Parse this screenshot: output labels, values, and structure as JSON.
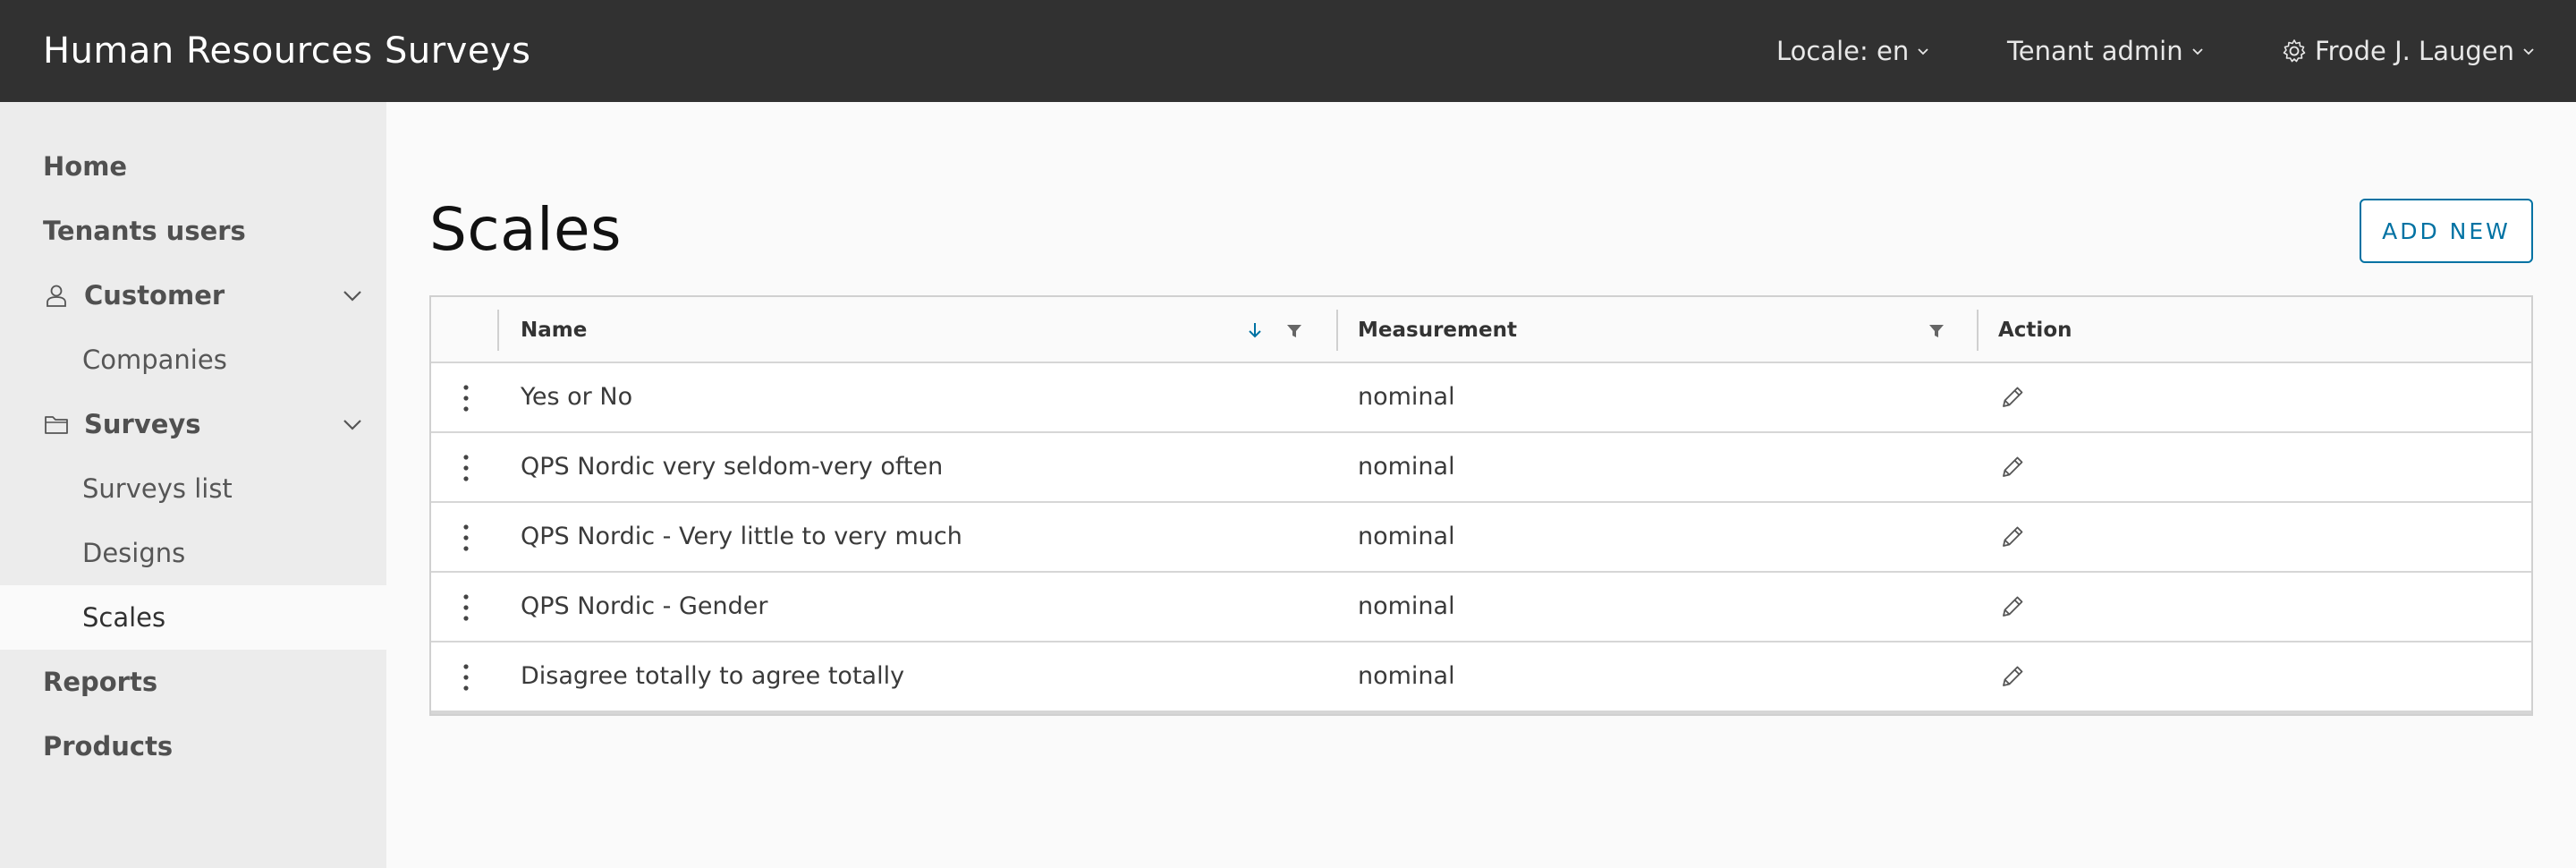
{
  "header": {
    "title": "Human Resources Surveys",
    "locale_label": "Locale: en",
    "tenant_label": "Tenant admin",
    "user_label": "Frode J. Laugen"
  },
  "sidebar": {
    "items": [
      {
        "label": "Home",
        "level": "top"
      },
      {
        "label": "Tenants users",
        "level": "top"
      },
      {
        "label": "Customer",
        "level": "top",
        "icon": "person-icon",
        "expanded": true
      },
      {
        "label": "Companies",
        "level": "sub"
      },
      {
        "label": "Surveys",
        "level": "top",
        "icon": "folder-icon",
        "expanded": true
      },
      {
        "label": "Surveys list",
        "level": "sub"
      },
      {
        "label": "Designs",
        "level": "sub"
      },
      {
        "label": "Scales",
        "level": "sub",
        "active": true
      },
      {
        "label": "Reports",
        "level": "top"
      },
      {
        "label": "Products",
        "level": "top"
      }
    ]
  },
  "main": {
    "title": "Scales",
    "add_button": "ADD NEW",
    "table": {
      "columns": [
        "Name",
        "Measurement",
        "Action"
      ],
      "rows": [
        {
          "name": "Yes or No",
          "measurement": "nominal"
        },
        {
          "name": "QPS Nordic very seldom-very often",
          "measurement": "nominal"
        },
        {
          "name": "QPS Nordic - Very little to very much",
          "measurement": "nominal"
        },
        {
          "name": "QPS Nordic - Gender",
          "measurement": "nominal"
        },
        {
          "name": "Disagree totally to agree totally",
          "measurement": "nominal"
        }
      ]
    }
  },
  "colors": {
    "header_bg": "#313131",
    "sidebar_bg": "#ececec",
    "accent": "#0072a3"
  }
}
